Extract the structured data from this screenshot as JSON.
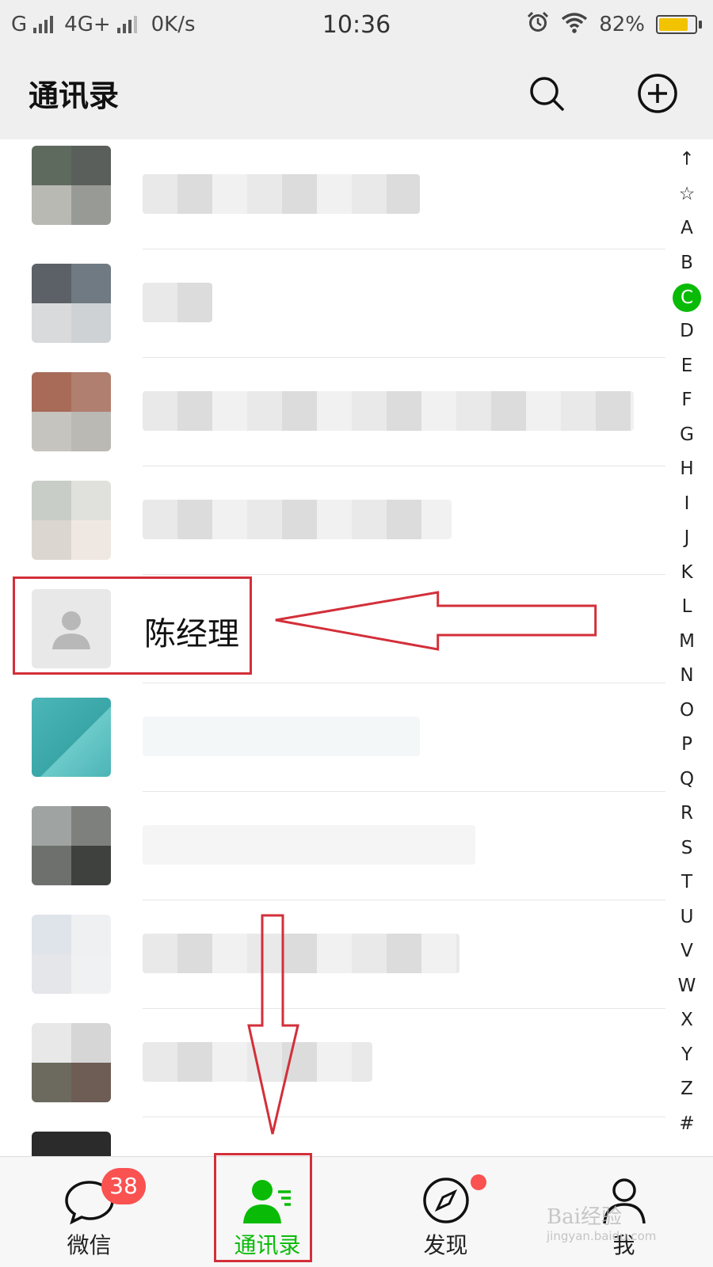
{
  "status_bar": {
    "carrier": "G",
    "network": "4G+",
    "speed": "0K/s",
    "time": "10:36",
    "battery": "82%",
    "battery_level": 0.82,
    "icons": [
      "signal-icon",
      "alarm-icon",
      "wifi-icon",
      "battery-icon"
    ]
  },
  "header": {
    "title": "通讯录",
    "search_icon": "search-icon",
    "add_icon": "plus-circle-icon"
  },
  "contacts": {
    "highlighted_name": "陈经理"
  },
  "alpha_index": {
    "letters": [
      "↑",
      "☆",
      "A",
      "B",
      "C",
      "D",
      "E",
      "F",
      "G",
      "H",
      "I",
      "J",
      "K",
      "L",
      "M",
      "N",
      "O",
      "P",
      "Q",
      "R",
      "S",
      "T",
      "U",
      "V",
      "W",
      "X",
      "Y",
      "Z",
      "#"
    ],
    "active": "C"
  },
  "tab_bar": {
    "tabs": [
      {
        "label": "微信",
        "icon": "chat-bubble-icon",
        "badge": "38"
      },
      {
        "label": "通讯录",
        "icon": "contacts-icon"
      },
      {
        "label": "发现",
        "icon": "compass-icon"
      },
      {
        "label": "我",
        "icon": "person-icon"
      }
    ],
    "active_index": 1
  },
  "colors": {
    "accent": "#09bb07",
    "badge": "#fa5151",
    "annotation": "#d32f3a",
    "header_bg": "#efefef"
  },
  "watermark": {
    "text": "Bai 经验",
    "sub": "jingyan.baidu.com"
  }
}
